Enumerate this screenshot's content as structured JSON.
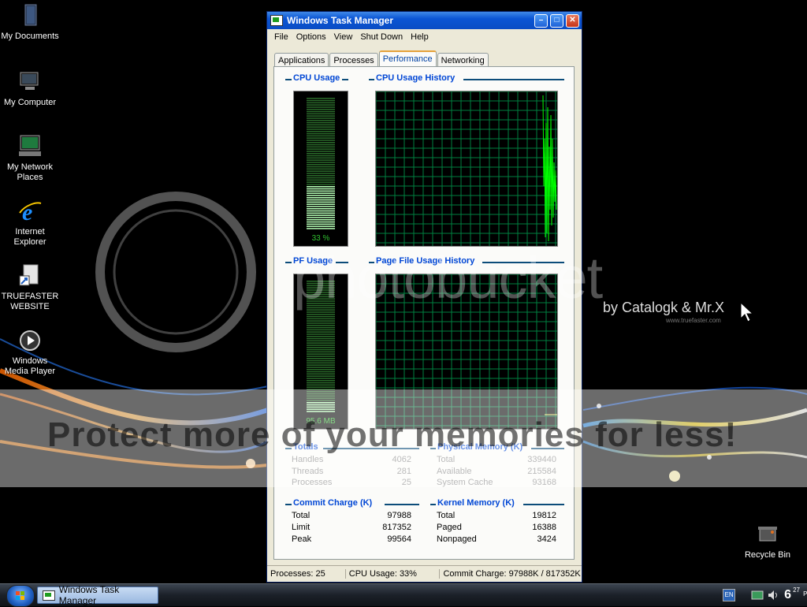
{
  "desktop": {
    "icons": [
      {
        "label": "My Documents",
        "icon": "folder-icon"
      },
      {
        "label": "My Computer",
        "icon": "computer-icon"
      },
      {
        "label": "My Network Places",
        "icon": "network-icon"
      },
      {
        "label": "Internet Explorer",
        "icon": "ie-icon"
      },
      {
        "label": "TRUEFASTER WEBSITE",
        "icon": "shortcut-icon"
      },
      {
        "label": "Windows Media Player",
        "icon": "media-player-icon"
      },
      {
        "label": "Recycle Bin",
        "icon": "recycle-bin-icon"
      }
    ],
    "watermark": {
      "logo": "photobucket",
      "byline": "by Catalogk & Mr.X",
      "site": "www.truefaster.com",
      "banner": "Protect more of your memories for less!"
    }
  },
  "window": {
    "title": "Windows Task Manager",
    "menu": [
      "File",
      "Options",
      "View",
      "Shut Down",
      "Help"
    ],
    "tabs": [
      "Applications",
      "Processes",
      "Performance",
      "Networking"
    ],
    "active_tab": "Performance",
    "groups": {
      "cpu_usage": "CPU Usage",
      "cpu_history": "CPU Usage History",
      "pf_usage": "PF Usage",
      "pf_history": "Page File Usage History"
    },
    "cpu_usage_percent": 33,
    "cpu_label": "33 %",
    "pf_usage_fraction": 0.09,
    "pf_label": "95.6 MB",
    "totals": {
      "title": "Totals",
      "rows": [
        {
          "label": "Handles",
          "value": "4062"
        },
        {
          "label": "Threads",
          "value": "281"
        },
        {
          "label": "Processes",
          "value": "25"
        }
      ]
    },
    "physical_memory": {
      "title": "Physical Memory (K)",
      "rows": [
        {
          "label": "Total",
          "value": "339440"
        },
        {
          "label": "Available",
          "value": "215584"
        },
        {
          "label": "System Cache",
          "value": "93168"
        }
      ]
    },
    "commit_charge": {
      "title": "Commit Charge (K)",
      "rows": [
        {
          "label": "Total",
          "value": "97988"
        },
        {
          "label": "Limit",
          "value": "817352"
        },
        {
          "label": "Peak",
          "value": "99564"
        }
      ]
    },
    "kernel_memory": {
      "title": "Kernel Memory (K)",
      "rows": [
        {
          "label": "Total",
          "value": "19812"
        },
        {
          "label": "Paged",
          "value": "16388"
        },
        {
          "label": "Nonpaged",
          "value": "3424"
        }
      ]
    },
    "status": {
      "processes": "Processes: 25",
      "cpu": "CPU Usage: 33%",
      "commit": "Commit Charge: 97988K / 817352K"
    },
    "colors": {
      "graph_line": "#00ff00",
      "grid": "#008040",
      "titlebar": "#0b55d4"
    }
  },
  "taskbar": {
    "task_button": "Windows Task Manager",
    "language": "EN",
    "clock_hour": "6",
    "clock_minute": "27",
    "clock_ampm": "PM"
  }
}
